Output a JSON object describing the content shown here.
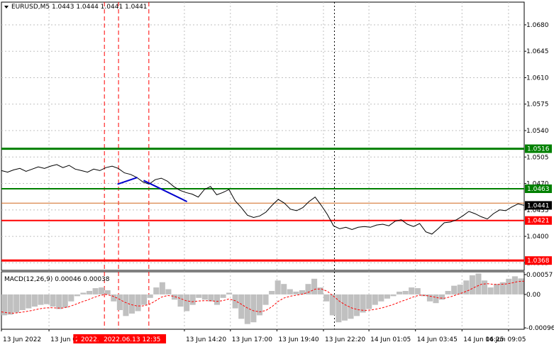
{
  "chart_data": {
    "type": "line",
    "title": "EURUSD,M5  1.0443 1.0444 1.0441 1.0441",
    "price": {
      "ylim": [
        1.0355,
        1.071
      ],
      "y_ticks": [
        "1.0680",
        "1.0645",
        "1.0610",
        "1.0575",
        "1.0540",
        "1.0505",
        "1.0470",
        "1.0435",
        "1.0400",
        "1.0365"
      ],
      "series": [
        {
          "values": [
            1.0487,
            1.0485,
            1.0488,
            1.049,
            1.0486,
            1.0489,
            1.0492,
            1.049,
            1.0493,
            1.0495,
            1.0491,
            1.0494,
            1.0489,
            1.0487,
            1.0485,
            1.0489,
            1.0487,
            1.0491,
            1.0493,
            1.049,
            1.0484,
            1.0482,
            1.0478,
            1.0472,
            1.0469,
            1.0475,
            1.0477,
            1.0473,
            1.0466,
            1.0461,
            1.0458,
            1.0456,
            1.0452,
            1.0462,
            1.0466,
            1.0455,
            1.0458,
            1.0462,
            1.0447,
            1.0438,
            1.0428,
            1.0425,
            1.0427,
            1.0432,
            1.0441,
            1.0449,
            1.0444,
            1.0436,
            1.0434,
            1.0438,
            1.0446,
            1.0452,
            1.0441,
            1.0429,
            1.0414,
            1.041,
            1.0412,
            1.0409,
            1.0412,
            1.0413,
            1.0412,
            1.0415,
            1.0416,
            1.0414,
            1.042,
            1.0422,
            1.0416,
            1.0413,
            1.0417,
            1.0406,
            1.0403,
            1.041,
            1.0418,
            1.0419,
            1.0422,
            1.0427,
            1.0433,
            1.043,
            1.0426,
            1.0423,
            1.043,
            1.0435,
            1.0434,
            1.0439,
            1.0443,
            1.0441
          ]
        }
      ],
      "levels": [
        {
          "label": "1.0516",
          "value": 1.0516,
          "color": "#008000",
          "width": 3
        },
        {
          "label": "1.0463",
          "value": 1.0463,
          "color": "#008000",
          "width": 2
        },
        {
          "label": "1.0421",
          "value": 1.0421,
          "color": "#ff0000",
          "width": 2
        },
        {
          "label": "1.0368",
          "value": 1.0368,
          "color": "#ff0000",
          "width": 3
        },
        {
          "value": 1.0444,
          "color": "#d2691e",
          "width": 1
        }
      ],
      "current": {
        "label": "1.0441",
        "value": 1.0441
      },
      "trend_lines": [
        {
          "from": [
            0.222,
            1.0469
          ],
          "to": [
            0.26,
            1.0478
          ],
          "color": "#0000cd"
        },
        {
          "from": [
            0.272,
            1.0474
          ],
          "to": [
            0.355,
            1.0446
          ],
          "color": "#0000cd"
        }
      ],
      "vlines": [
        {
          "x": 0.197,
          "color": "#ff0000",
          "dash": "6,4"
        },
        {
          "x": 0.224,
          "color": "#ff0000",
          "dash": "6,4"
        },
        {
          "x": 0.282,
          "color": "#ff0000",
          "dash": "6,4"
        },
        {
          "x": 0.637,
          "color": "#000000",
          "dash": "2,3"
        }
      ]
    },
    "macd": {
      "title": "MACD(12,26,9) 0.00046 0.00038",
      "ylim": [
        -0.001,
        0.00065
      ],
      "y_ticks": [
        "0.00057",
        "0.00",
        "-0.00096"
      ],
      "histogram": [
        -0.0006,
        -0.00058,
        -0.00052,
        -0.00045,
        -0.0004,
        -0.00035,
        -0.0003,
        -0.00028,
        -0.00035,
        -0.00042,
        -0.00038,
        -0.0002,
        -5e-05,
        5e-05,
        0.0001,
        0.00018,
        0.0002,
        0.00012,
        -0.0002,
        -0.00045,
        -0.00062,
        -0.00055,
        -0.00048,
        -0.0003,
        -0.0001,
        0.0002,
        0.00035,
        0.00015,
        -0.00015,
        -0.00035,
        -0.00048,
        -0.0003,
        -0.0001,
        -0.00015,
        -0.0002,
        -0.0003,
        -0.0001,
        5e-05,
        -0.0004,
        -0.0007,
        -0.00085,
        -0.0008,
        -0.0006,
        -0.0003,
        0.0001,
        0.0004,
        0.0003,
        0.00015,
        8e-05,
        0.00012,
        0.0003,
        0.00045,
        0.0002,
        -0.0002,
        -0.0006,
        -0.0008,
        -0.00075,
        -0.0007,
        -0.00062,
        -0.00052,
        -0.00042,
        -0.0003,
        -0.0002,
        -0.00012,
        -5e-05,
        8e-05,
        0.0001,
        0.0002,
        0.00018,
        -5e-05,
        -0.0002,
        -0.00025,
        -0.00015,
        0.0001,
        0.00025,
        0.00028,
        0.0004,
        0.00055,
        0.0006,
        0.0004,
        0.0002,
        0.0003,
        0.00035,
        0.00045,
        0.00052,
        0.00046
      ],
      "signal": [
        -0.0005,
        -0.00053,
        -0.00054,
        -0.00052,
        -0.00049,
        -0.00046,
        -0.00042,
        -0.00039,
        -0.00038,
        -0.00039,
        -0.00039,
        -0.00035,
        -0.00029,
        -0.00022,
        -0.00016,
        -9e-05,
        -3e-05,
        0.0,
        -4e-05,
        -0.00012,
        -0.00022,
        -0.00029,
        -0.00033,
        -0.00033,
        -0.00029,
        -0.00019,
        -8e-05,
        -3e-05,
        -5e-05,
        -0.00011,
        -0.00018,
        -0.00021,
        -0.00019,
        -0.00018,
        -0.00018,
        -0.0002,
        -0.00018,
        -0.00013,
        -0.00018,
        -0.00028,
        -0.00039,
        -0.00047,
        -0.0005,
        -0.00046,
        -0.00035,
        -0.0002,
        -0.0001,
        -5e-05,
        -2e-05,
        1e-05,
        7e-05,
        0.00015,
        0.00016,
        9e-05,
        -5e-05,
        -0.0002,
        -0.00031,
        -0.00039,
        -0.00044,
        -0.00046,
        -0.00045,
        -0.00042,
        -0.00038,
        -0.00033,
        -0.00027,
        -0.0002,
        -0.00014,
        -7e-05,
        -2e-05,
        -3e-05,
        -6e-05,
        -0.0001,
        -0.00011,
        -7e-05,
        -1e-05,
        5e-05,
        0.00012,
        0.00021,
        0.00029,
        0.00031,
        0.00029,
        0.00029,
        0.0003,
        0.00033,
        0.00037,
        0.00038
      ]
    },
    "x_ticks": [
      "13 Jun 2022",
      "13 Jun 06:2",
      "13 Jun 14:20",
      "13 Jun 17:00",
      "13 Jun 19:40",
      "13 Jun 22:20",
      "14 Jun 01:05",
      "14 Jun 03:45",
      "14 Jun 06:25",
      "14 Jun 09:05"
    ],
    "x_tick_pos": [
      0.0,
      0.091,
      0.35,
      0.438,
      0.527,
      0.616,
      0.703,
      0.792,
      0.881,
      0.97
    ],
    "x_markers": [
      {
        "label": "202",
        "x": 0.153
      },
      {
        "label": "2022.06.1",
        "x": 0.183
      },
      {
        "label": "2022.06.13 12:35",
        "x": 0.25
      }
    ]
  },
  "colors": {
    "background": "#ffffff",
    "grid": "#c0c0c0",
    "price_line": "#000000",
    "macd_hist": "#c0c0c0",
    "macd_signal": "#ff0000",
    "marker_tag": "#ff0000"
  }
}
